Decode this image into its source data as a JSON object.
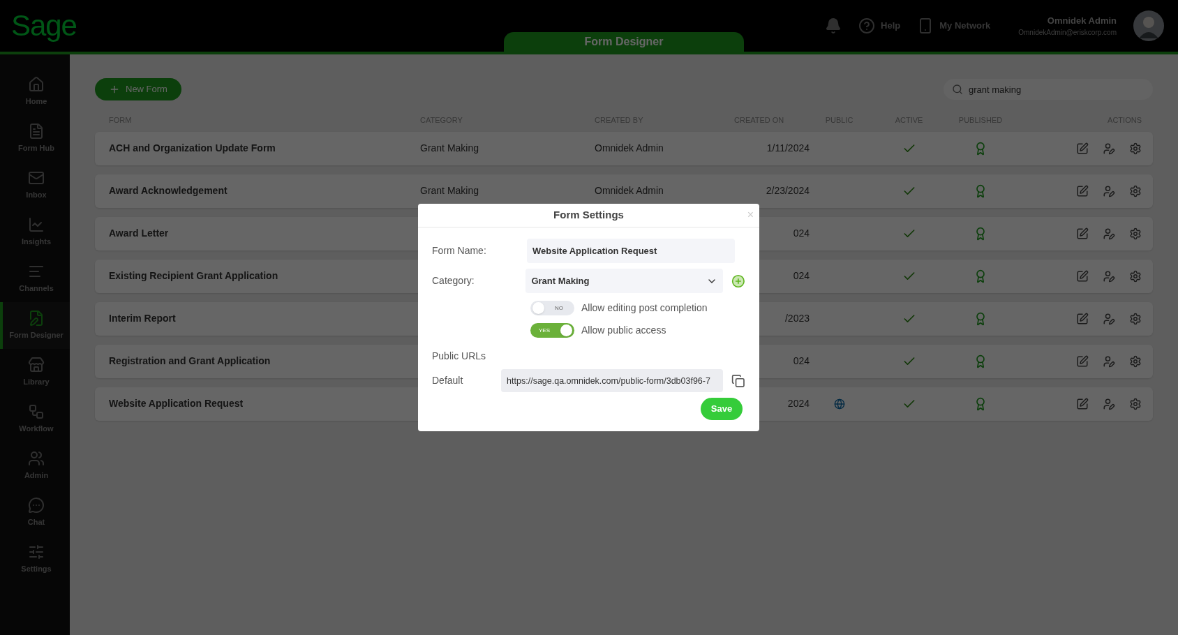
{
  "topbar": {
    "logo": "Sage",
    "app_tab": "Form Designer",
    "help": "Help",
    "network": "My Network",
    "user_name": "Omnidek Admin",
    "user_email": "OmnidekAdmin@eriskcorp.com"
  },
  "sidebar": {
    "items": [
      {
        "label": "Home",
        "selected": false
      },
      {
        "label": "Form Hub",
        "selected": false
      },
      {
        "label": "Inbox",
        "selected": false
      },
      {
        "label": "Insights",
        "selected": false
      },
      {
        "label": "Channels",
        "selected": false
      },
      {
        "label": "Form Designer",
        "selected": true
      },
      {
        "label": "Library",
        "selected": false
      },
      {
        "label": "Workflow",
        "selected": false
      },
      {
        "label": "Admin",
        "selected": false
      },
      {
        "label": "Chat",
        "selected": false
      },
      {
        "label": "Settings",
        "selected": false
      }
    ]
  },
  "new_form_button": "New Form",
  "search": {
    "value": "grant making"
  },
  "table": {
    "columns": [
      "FORM",
      "CATEGORY",
      "CREATED BY",
      "CREATED ON",
      "PUBLIC",
      "ACTIVE",
      "PUBLISHED",
      "ACTIONS"
    ],
    "rows": [
      {
        "form": "ACH and Organization Update Form",
        "category": "Grant Making",
        "created_by": "Omnidek Admin",
        "created_on": "1/11/2024",
        "public": false,
        "active": true,
        "published": true
      },
      {
        "form": "Award Acknowledgement",
        "category": "Grant Making",
        "created_by": "Omnidek Admin",
        "created_on": "2/23/2024",
        "public": false,
        "active": true,
        "published": true
      },
      {
        "form": "Award Letter",
        "created_on": "024",
        "public": false,
        "active": true,
        "published": true
      },
      {
        "form": "Existing Recipient Grant Application",
        "created_on": "024",
        "public": false,
        "active": true,
        "published": true
      },
      {
        "form": "Interim Report",
        "created_on": "/2023",
        "public": false,
        "active": true,
        "published": true
      },
      {
        "form": "Registration and Grant Application",
        "created_on": "024",
        "public": false,
        "active": true,
        "published": true
      },
      {
        "form": "Website Application Request",
        "created_on": "2024",
        "public": true,
        "active": true,
        "published": true
      }
    ]
  },
  "dialog": {
    "title": "Form Settings",
    "close": "×",
    "form_name_label": "Form Name:",
    "form_name_value": "Website Application Request",
    "category_label": "Category:",
    "category_value": "Grant Making",
    "toggles": [
      {
        "label": "Allow editing post completion",
        "on": false,
        "text": "NO"
      },
      {
        "label": "Allow public access",
        "on": true,
        "text": "YES"
      }
    ],
    "public_urls_label": "Public URLs",
    "default_label": "Default",
    "default_url": "https://sage.qa.omnidek.com/public-form/3db03f96-7",
    "save_button": "Save"
  }
}
